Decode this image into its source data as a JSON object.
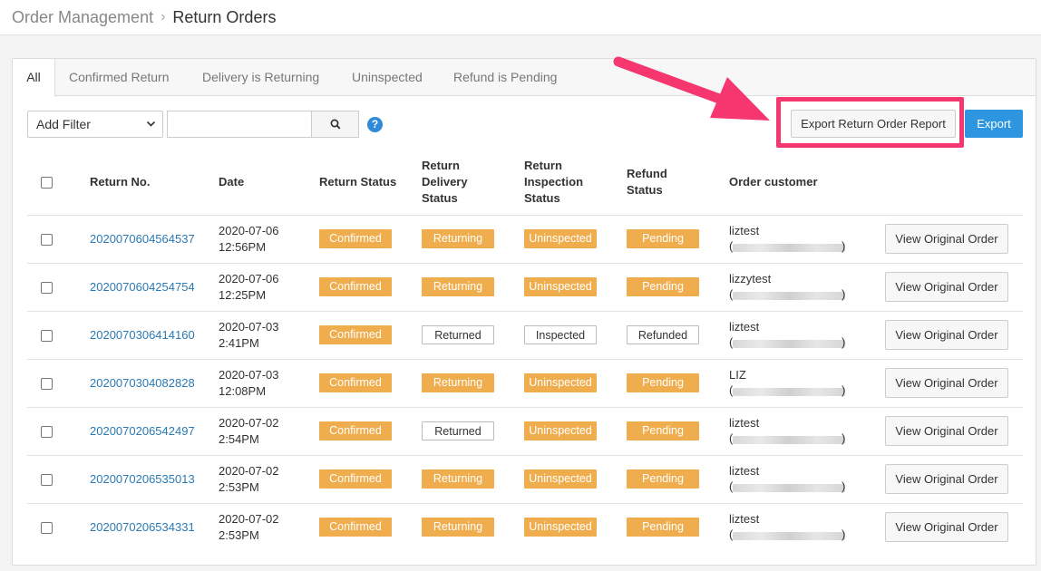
{
  "breadcrumb": {
    "parent": "Order Management",
    "separator": "›",
    "current": "Return Orders"
  },
  "tabs": [
    "All",
    "Confirmed Return",
    "Delivery is Returning",
    "Uninspected",
    "Refund is Pending"
  ],
  "toolbar": {
    "filter_value": "Add Filter",
    "search_value": "",
    "export_report_label": "Export Return Order Report",
    "export_label": "Export"
  },
  "colors": {
    "accent": "#2e96e0",
    "badge_orange": "#efad4e",
    "link": "#2a7ab5",
    "highlight": "#f5366f"
  },
  "table": {
    "headers": {
      "return_no": "Return No.",
      "date": "Date",
      "return_status": "Return Status",
      "delivery_1": "Return",
      "delivery_2": "Delivery",
      "delivery_3": "Status",
      "inspection_1": "Return",
      "inspection_2": "Inspection",
      "inspection_3": "Status",
      "refund_1": "Refund",
      "refund_2": "Status",
      "customer": "Order customer"
    },
    "view_label": "View Original Order",
    "rows": [
      {
        "return_no": "2020070604564537",
        "date": "2020-07-06",
        "time": "12:56PM",
        "return_status": "Confirmed",
        "delivery": "Returning",
        "inspection": "Uninspected",
        "refund": "Pending",
        "customer": "liztest"
      },
      {
        "return_no": "2020070604254754",
        "date": "2020-07-06",
        "time": "12:25PM",
        "return_status": "Confirmed",
        "delivery": "Returning",
        "inspection": "Uninspected",
        "refund": "Pending",
        "customer": "lizzytest"
      },
      {
        "return_no": "2020070306414160",
        "date": "2020-07-03",
        "time": "2:41PM",
        "return_status": "Confirmed",
        "delivery": "Returned",
        "inspection": "Inspected",
        "refund": "Refunded",
        "customer": "liztest"
      },
      {
        "return_no": "2020070304082828",
        "date": "2020-07-03",
        "time": "12:08PM",
        "return_status": "Confirmed",
        "delivery": "Returning",
        "inspection": "Uninspected",
        "refund": "Pending",
        "customer": "LIZ"
      },
      {
        "return_no": "2020070206542497",
        "date": "2020-07-02",
        "time": "2:54PM",
        "return_status": "Confirmed",
        "delivery": "Returned",
        "inspection": "Uninspected",
        "refund": "Pending",
        "customer": "liztest"
      },
      {
        "return_no": "2020070206535013",
        "date": "2020-07-02",
        "time": "2:53PM",
        "return_status": "Confirmed",
        "delivery": "Returning",
        "inspection": "Uninspected",
        "refund": "Pending",
        "customer": "liztest"
      },
      {
        "return_no": "2020070206534331",
        "date": "2020-07-02",
        "time": "2:53PM",
        "return_status": "Confirmed",
        "delivery": "Returning",
        "inspection": "Uninspected",
        "refund": "Pending",
        "customer": "liztest"
      }
    ]
  }
}
